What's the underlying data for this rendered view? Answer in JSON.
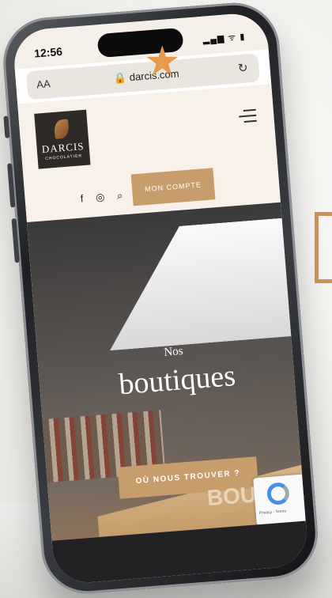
{
  "status_bar": {
    "time": "12:56",
    "signal": "▂▄▆ ᯤ ▮"
  },
  "browser": {
    "text_size": "AA",
    "url": "🔒 darcis.com",
    "reload_icon": "reload-icon"
  },
  "site": {
    "logo_name": "DARCIS",
    "logo_sub": "CHOCOLATIER",
    "menu_icon": "hamburger-icon",
    "social": {
      "facebook": "f",
      "instagram": "◎",
      "search": "⌕"
    },
    "account_button": "MON COMPTE"
  },
  "hero": {
    "pre_title": "Nos",
    "title": "boutiques",
    "cta": "OÙ NOUS TROUVER ?",
    "store_sign": "BOUTIQUE"
  },
  "recaptcha": {
    "label": "Privacy - Terms"
  },
  "colors": {
    "accent": "#c89d6c",
    "star": "#e89a4c",
    "logo_bg": "#2d2a28"
  }
}
